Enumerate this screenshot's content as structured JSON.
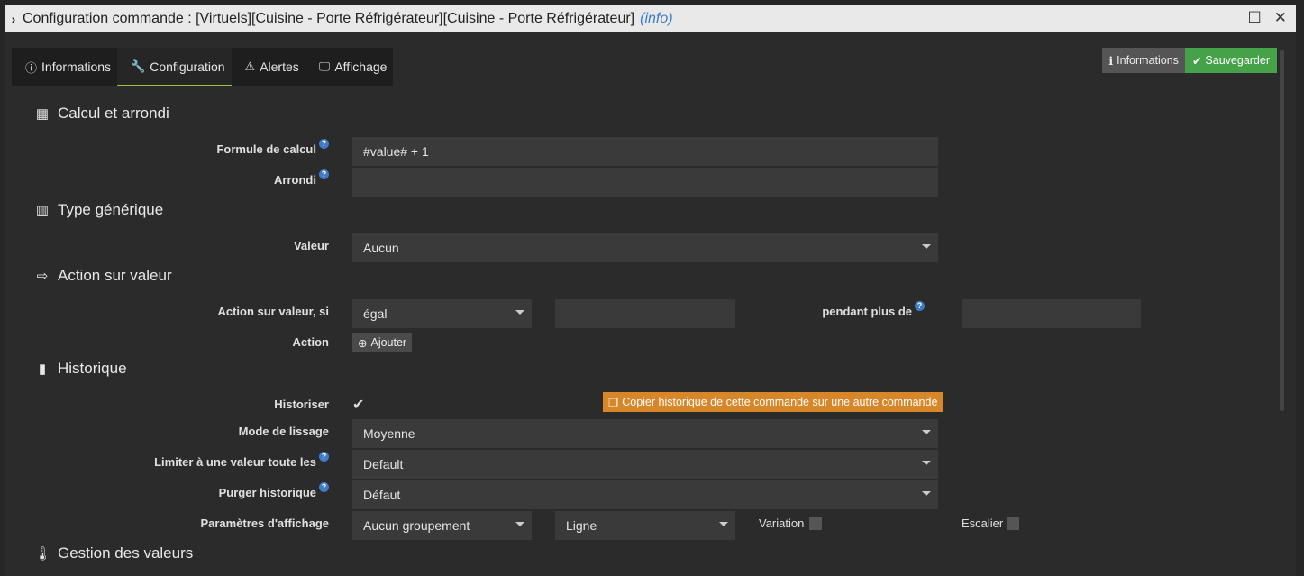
{
  "window": {
    "title": "Configuration commande : [Virtuels][Cuisine - Porte Réfrigérateur][Cuisine - Porte Réfrigérateur]",
    "info_tag": "(info)",
    "chevron": "›",
    "maximize": "☐",
    "close": "✕"
  },
  "tabs": [
    {
      "label": "Informations",
      "icon": "info-circle-icon"
    },
    {
      "label": "Configuration",
      "icon": "wrench-icon"
    },
    {
      "label": "Alertes",
      "icon": "warning-icon"
    },
    {
      "label": "Affichage",
      "icon": "monitor-icon"
    }
  ],
  "toolbar": {
    "info_label": "Informations",
    "save_label": "Sauvegarder"
  },
  "sections": {
    "calcul": "Calcul et arrondi",
    "type": "Type générique",
    "action": "Action sur valeur",
    "historique": "Historique",
    "gestion": "Gestion des valeurs"
  },
  "fields": {
    "formule_label": "Formule de calcul",
    "formule_value": "#value# + 1",
    "arrondi_label": "Arrondi",
    "arrondi_value": "",
    "valeur_label": "Valeur",
    "valeur_value": "Aucun",
    "action_si_label": "Action sur valeur, si",
    "action_si_value": "égal",
    "action_si_input": "",
    "pendant_label": "pendant plus de",
    "pendant_value": "",
    "action_label": "Action",
    "ajouter_label": "Ajouter",
    "historiser_label": "Historiser",
    "copier_label": "Copier historique de cette commande sur une autre commande",
    "lissage_label": "Mode de lissage",
    "lissage_value": "Moyenne",
    "limiter_label": "Limiter à une valeur toute les",
    "limiter_value": "Default",
    "purger_label": "Purger historique",
    "purger_value": "Défaut",
    "affichage_label": "Paramètres d'affichage",
    "groupement_value": "Aucun groupement",
    "ligne_value": "Ligne",
    "variation_label": "Variation",
    "escalier_label": "Escalier"
  }
}
